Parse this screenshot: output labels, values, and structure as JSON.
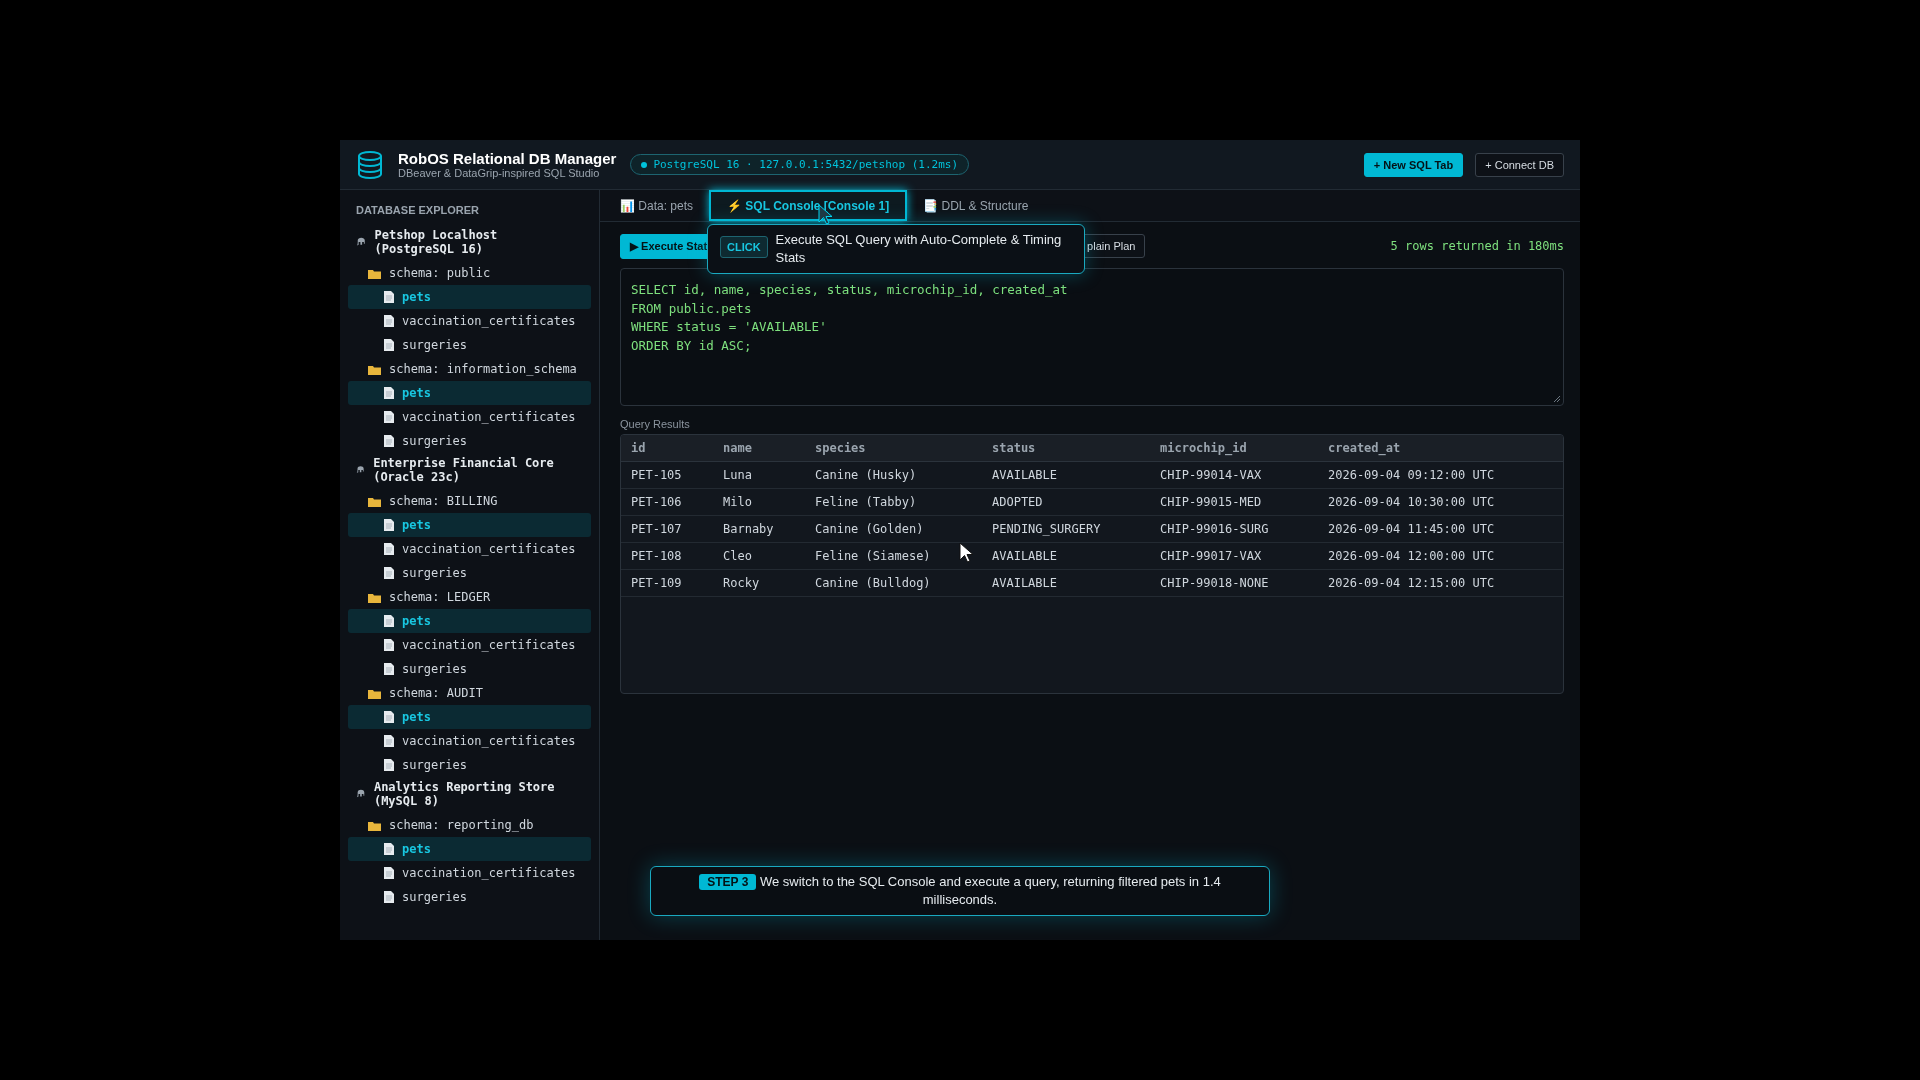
{
  "header": {
    "title": "RobOS Relational DB Manager",
    "subtitle": "DBeaver & DataGrip-inspired SQL Studio",
    "connection_status": "PostgreSQL 16 · 127.0.0.1:5432/petshop (1.2ms)",
    "connected": true,
    "buttons": [
      {
        "label": "+ New SQL Tab",
        "kind": "primary"
      },
      {
        "label": "+ Connect DB",
        "kind": "secondary"
      }
    ]
  },
  "sidebar": {
    "title": "DATABASE EXPLORER",
    "tree": [
      {
        "label": "Petshop Localhost (PostgreSQL 16)",
        "kind": "connection",
        "children": [
          {
            "label": "schema: public",
            "kind": "schema",
            "children": [
              {
                "label": "pets",
                "kind": "table",
                "selected": true
              },
              {
                "label": "vaccination_certificates",
                "kind": "table",
                "selected": false
              },
              {
                "label": "surgeries",
                "kind": "table",
                "selected": false
              }
            ]
          },
          {
            "label": "schema: information_schema",
            "kind": "schema",
            "children": [
              {
                "label": "pets",
                "kind": "table",
                "selected": true
              },
              {
                "label": "vaccination_certificates",
                "kind": "table",
                "selected": false
              },
              {
                "label": "surgeries",
                "kind": "table",
                "selected": false
              }
            ]
          }
        ]
      },
      {
        "label": "Enterprise Financial Core (Oracle 23c)",
        "kind": "connection",
        "children": [
          {
            "label": "schema: BILLING",
            "kind": "schema",
            "children": [
              {
                "label": "pets",
                "kind": "table",
                "selected": true
              },
              {
                "label": "vaccination_certificates",
                "kind": "table",
                "selected": false
              },
              {
                "label": "surgeries",
                "kind": "table",
                "selected": false
              }
            ]
          },
          {
            "label": "schema: LEDGER",
            "kind": "schema",
            "children": [
              {
                "label": "pets",
                "kind": "table",
                "selected": true
              },
              {
                "label": "vaccination_certificates",
                "kind": "table",
                "selected": false
              },
              {
                "label": "surgeries",
                "kind": "table",
                "selected": false
              }
            ]
          },
          {
            "label": "schema: AUDIT",
            "kind": "schema",
            "children": [
              {
                "label": "pets",
                "kind": "table",
                "selected": true
              },
              {
                "label": "vaccination_certificates",
                "kind": "table",
                "selected": false
              },
              {
                "label": "surgeries",
                "kind": "table",
                "selected": false
              }
            ]
          }
        ]
      },
      {
        "label": "Analytics Reporting Store (MySQL 8)",
        "kind": "connection",
        "children": [
          {
            "label": "schema: reporting_db",
            "kind": "schema",
            "children": [
              {
                "label": "pets",
                "kind": "table",
                "selected": true
              },
              {
                "label": "vaccination_certificates",
                "kind": "table",
                "selected": false
              },
              {
                "label": "surgeries",
                "kind": "table",
                "selected": false
              }
            ]
          }
        ]
      }
    ]
  },
  "tabs": [
    {
      "label": "📊 Data: pets",
      "selected": false
    },
    {
      "label": "⚡ SQL Console [Console 1]",
      "selected": true
    },
    {
      "label": "📑 DDL & Structure",
      "selected": false
    }
  ],
  "toolbar": {
    "buttons": [
      {
        "label": "▶ Execute Stat",
        "kind": "primary"
      },
      {
        "label": "plain Plan",
        "kind": "secondary"
      }
    ],
    "result_summary": "5 rows returned in 180ms"
  },
  "editor": {
    "lines": [
      "SELECT id, name, species, status, microchip_id, created_at",
      "FROM public.pets",
      "WHERE status = 'AVAILABLE'",
      "ORDER BY id ASC;"
    ]
  },
  "results": {
    "label": "Query Results",
    "columns": [
      "id",
      "name",
      "species",
      "status",
      "microchip_id",
      "created_at"
    ],
    "rows": [
      [
        "PET-105",
        "Luna",
        "Canine (Husky)",
        "AVAILABLE",
        "CHIP-99014-VAX",
        "2026-09-04 09:12:00 UTC"
      ],
      [
        "PET-106",
        "Milo",
        "Feline (Tabby)",
        "ADOPTED",
        "CHIP-99015-MED",
        "2026-09-04 10:30:00 UTC"
      ],
      [
        "PET-107",
        "Barnaby",
        "Canine (Golden)",
        "PENDING_SURGERY",
        "CHIP-99016-SURG",
        "2026-09-04 11:45:00 UTC"
      ],
      [
        "PET-108",
        "Cleo",
        "Feline (Siamese)",
        "AVAILABLE",
        "CHIP-99017-VAX",
        "2026-09-04 12:00:00 UTC"
      ],
      [
        "PET-109",
        "Rocky",
        "Canine (Bulldog)",
        "AVAILABLE",
        "CHIP-99018-NONE",
        "2026-09-04 12:15:00 UTC"
      ]
    ]
  },
  "tooltip": {
    "badge": "CLICK",
    "text": "Execute SQL Query with Auto-Complete & Timing Stats"
  },
  "caption": {
    "badge": "STEP 3",
    "text": "We switch to the SQL Console and execute a query, returning filtered pets in 1.4 milliseconds."
  }
}
